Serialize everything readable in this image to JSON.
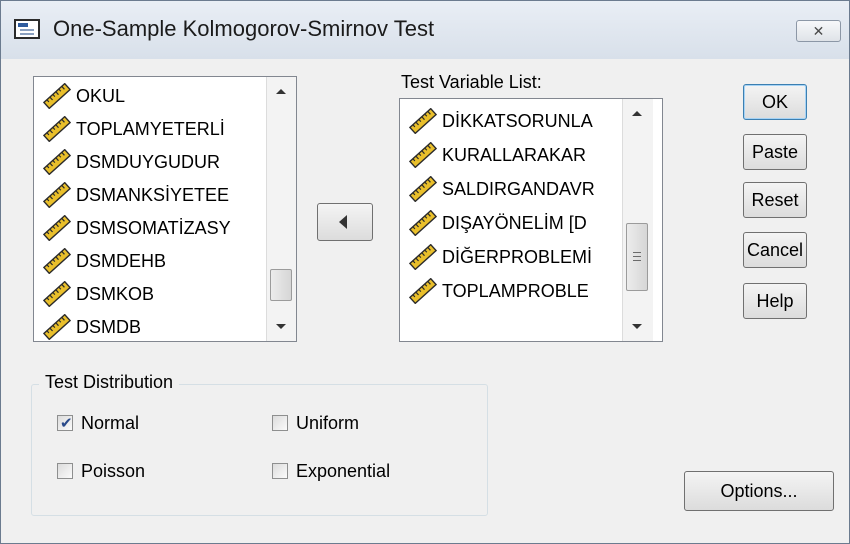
{
  "dialog": {
    "title": "One-Sample Kolmogorov-Smirnov Test",
    "close_glyph": "✕"
  },
  "source_list": {
    "items": [
      "OKUL",
      "TOPLAMYETERLİ",
      "DSMDUYGUDUR",
      "DSMANKSİYETEE",
      "DSMSOMATİZASY",
      "DSMDEHB",
      "DSMKOB",
      "DSMDB"
    ]
  },
  "test_variable_list": {
    "label": "Test Variable List:",
    "items": [
      "DİKKATSORUNLA",
      "KURALLARAKAR",
      "SALDIRGANDAVR",
      "DIŞAYÖNELİM [D",
      "DİĞERPROBLEMİ",
      "TOPLAMPROBLE"
    ]
  },
  "buttons": {
    "ok": "OK",
    "paste": "Paste",
    "reset": "Reset",
    "cancel": "Cancel",
    "help": "Help",
    "options": "Options..."
  },
  "test_distribution": {
    "title": "Test Distribution",
    "normal": {
      "label": "Normal",
      "checked": true
    },
    "uniform": {
      "label": "Uniform",
      "checked": false
    },
    "poisson": {
      "label": "Poisson",
      "checked": false
    },
    "exponential": {
      "label": "Exponential",
      "checked": false
    }
  },
  "icons": {
    "variable": "ruler-icon",
    "move": "arrow-left-icon",
    "app": "dialog-icon"
  },
  "colors": {
    "titlebar": "#dee5ee",
    "dialog_bg": "#f0f0f0",
    "ruler_fill": "#e9bf2b",
    "check": "#2a4a8a"
  }
}
